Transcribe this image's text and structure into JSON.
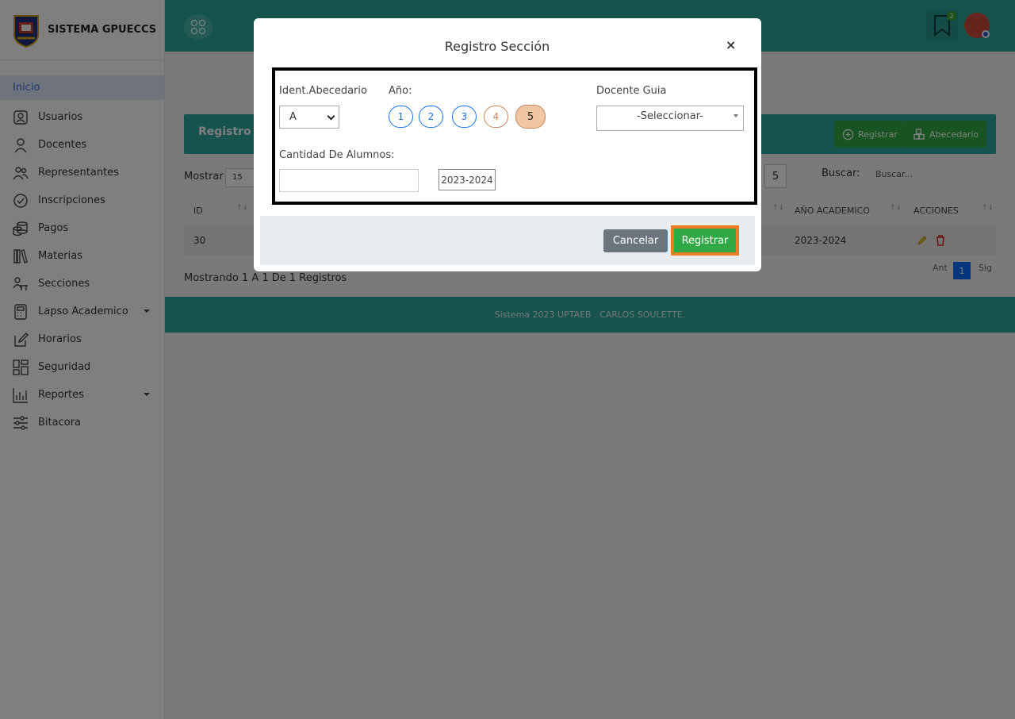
{
  "brand": {
    "title": "SISTEMA GPUECCS"
  },
  "sidebar": {
    "items": [
      {
        "label": "Inicio",
        "icon": "home-icon"
      },
      {
        "label": "Usuarios",
        "icon": "user-badge-icon"
      },
      {
        "label": "Docentes",
        "icon": "person-icon"
      },
      {
        "label": "Representantes",
        "icon": "people-icon"
      },
      {
        "label": "Inscripciones",
        "icon": "check-circle-icon"
      },
      {
        "label": "Pagos",
        "icon": "coins-icon"
      },
      {
        "label": "Materias",
        "icon": "books-icon"
      },
      {
        "label": "Secciones",
        "icon": "person-desk-icon"
      },
      {
        "label": "Lapso Academico",
        "icon": "calculator-icon"
      },
      {
        "label": "Horarios",
        "icon": "edit-icon"
      },
      {
        "label": "Seguridad",
        "icon": "dashboard-icon"
      },
      {
        "label": "Reportes",
        "icon": "chart-icon"
      },
      {
        "label": "Bitacora",
        "icon": "sliders-icon"
      }
    ]
  },
  "topbar": {
    "notification_count": "2"
  },
  "page": {
    "card_title": "Registro D",
    "btn_registrar": "Registrar",
    "btn_abecedario": "Abecedario",
    "mostrar_label": "Mostrar",
    "mostrar_value": "15",
    "page_num": "5",
    "buscar_label": "Buscar:",
    "buscar_placeholder": "Buscar...",
    "columns": {
      "id": "ID",
      "anio": "AÑO ACADEMICO",
      "acciones": "ACCIONES"
    },
    "row": {
      "id": "30",
      "anio": "2023-2024"
    },
    "mostrando": "Mostrando 1 A 1 De 1 Registros",
    "pager": {
      "prev": "Ant",
      "current": "1",
      "next": "Sig"
    },
    "footer": "Sistema 2023 UPTAEB . CARLOS SOULETTE."
  },
  "modal": {
    "title": "Registro Sección",
    "close": "×",
    "ident_label": "Ident.Abecedario",
    "ident_value": "A",
    "anio_label": "Año:",
    "years": [
      "1",
      "2",
      "3",
      "4",
      "5"
    ],
    "docente_label": "Docente Guia",
    "docente_value": "-Seleccionar-",
    "cantidad_label": "Cantidad De Alumnos:",
    "cantidad_value": "",
    "year_value": "2023-2024",
    "cancel_label": "Cancelar",
    "submit_label": "Registrar"
  }
}
